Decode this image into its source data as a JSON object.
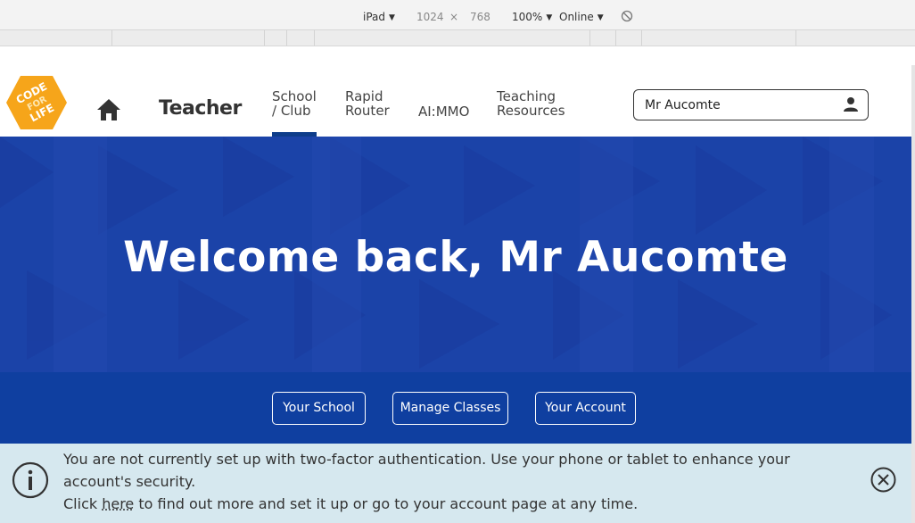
{
  "devtools": {
    "device": "iPad",
    "width": "1024",
    "times": "×",
    "height": "768",
    "zoom": "100%",
    "network": "Online"
  },
  "header": {
    "logo_text": [
      "CODE",
      "FOR",
      "LIFE"
    ],
    "section": "Teacher",
    "nav": [
      {
        "line1": "School",
        "line2": "/ Club",
        "active": true
      },
      {
        "line1": "Rapid",
        "line2": "Router"
      },
      {
        "line1": "AI:MMO",
        "line2": ""
      },
      {
        "line1": "Teaching",
        "line2": "Resources"
      }
    ],
    "user_name": "Mr Aucomte"
  },
  "hero": {
    "welcome": "Welcome back, Mr Aucomte"
  },
  "buttons": {
    "your_school": "Your School",
    "manage_classes": "Manage Classes",
    "your_account": "Your Account"
  },
  "alert": {
    "line1": "You are not currently set up with two-factor authentication. Use your phone or tablet to enhance your account's security.",
    "line2_pre": "Click ",
    "line2_link": "here",
    "line2_post": " to find out more and set it up or go to your account page at any time."
  },
  "colors": {
    "brand_orange": "#f6a51a",
    "hero_blue": "#1b43a8",
    "band_blue": "#0f3fa0",
    "alert_bg": "#d6e8ef"
  }
}
